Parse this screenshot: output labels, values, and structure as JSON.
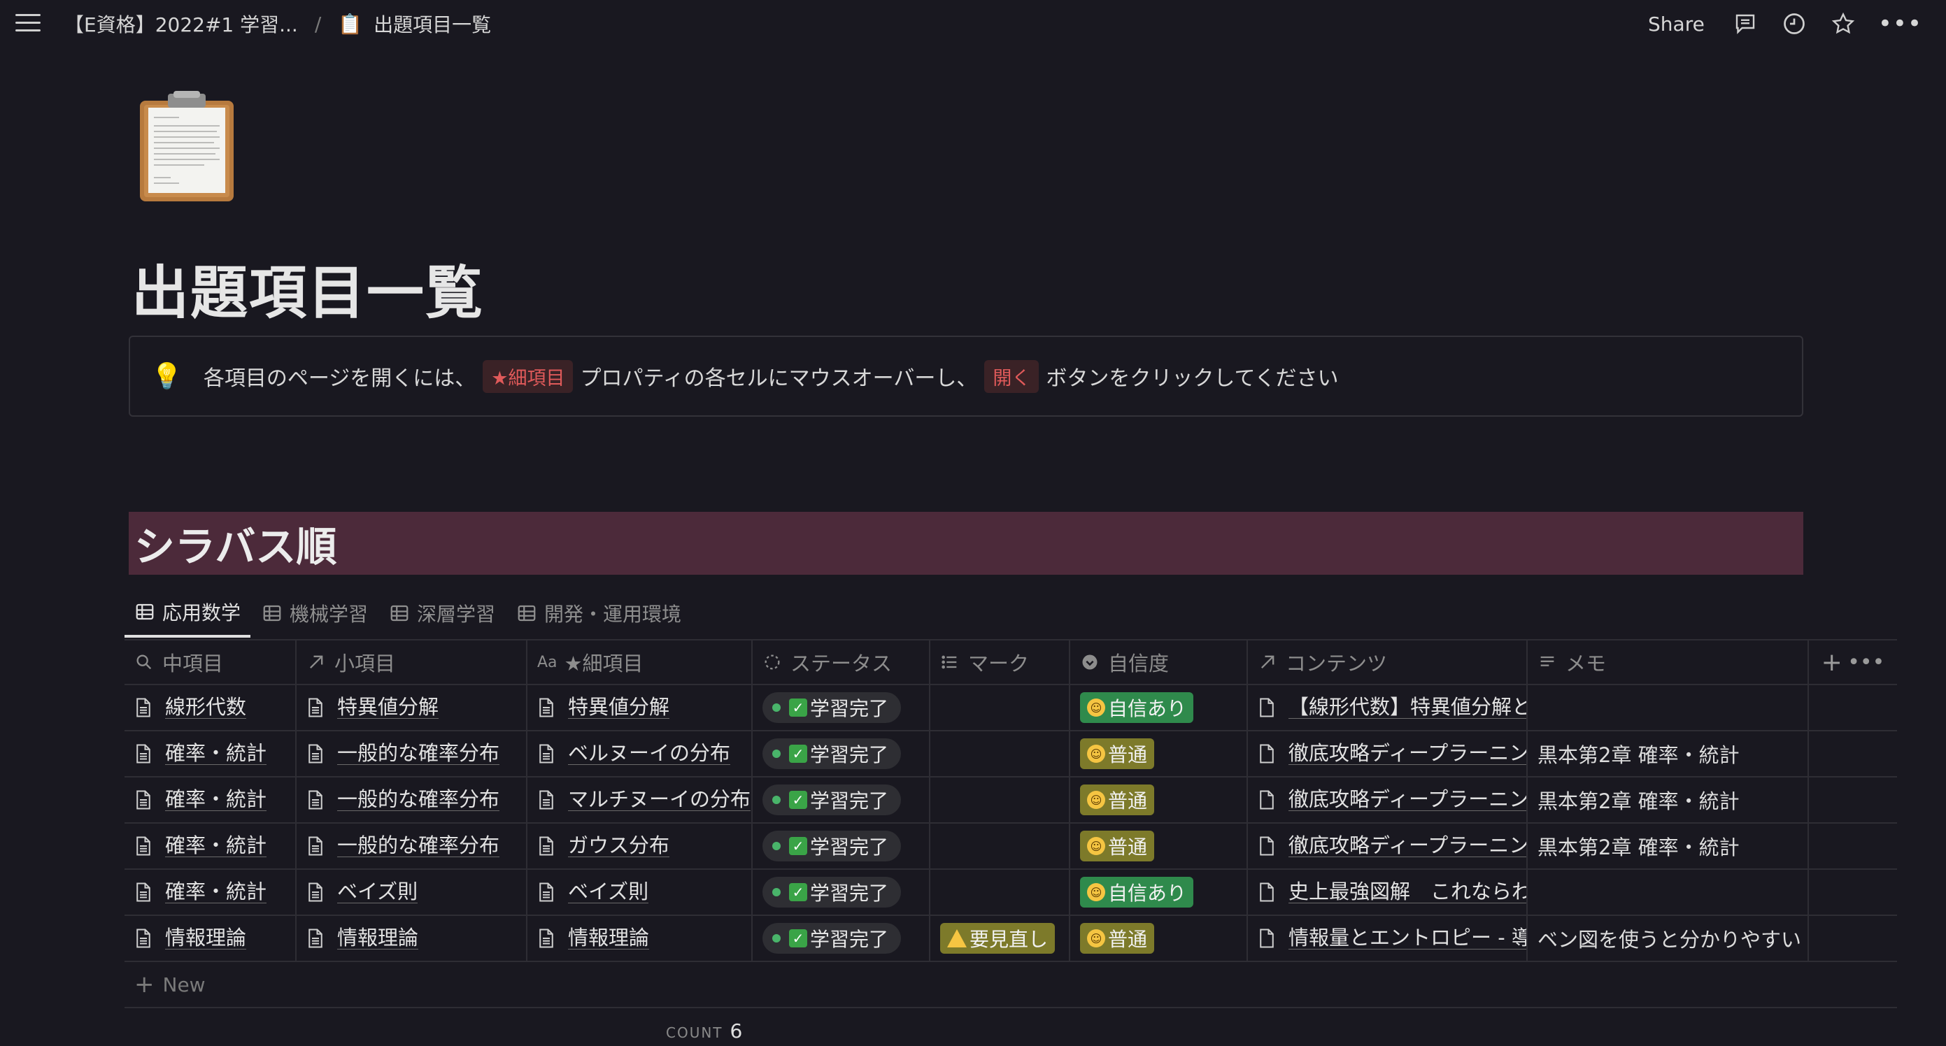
{
  "topbar": {
    "breadcrumb_parent": "【E資格】2022#1 学習...",
    "breadcrumb_sep": "/",
    "breadcrumb_current_icon": "📋",
    "breadcrumb_current": "出題項目一覧",
    "share_label": "Share",
    "icons": [
      "menu-icon",
      "comment-icon",
      "history-icon",
      "star-icon",
      "more-icon"
    ],
    "more_glyph": "•••"
  },
  "page": {
    "icon": "clipboard-icon",
    "title": "出題項目一覧"
  },
  "callout": {
    "icon": "💡",
    "text_1": "各項目のページを開くには、",
    "chip_1": "★細項目",
    "text_2": "プロパティの各セルにマウスオーバーし、",
    "chip_2": "開く",
    "text_3": "ボタンをクリックしてください"
  },
  "section": {
    "heading": "シラバス順"
  },
  "tabs": [
    {
      "label": "応用数学",
      "active": true
    },
    {
      "label": "機械学習",
      "active": false
    },
    {
      "label": "深層学習",
      "active": false
    },
    {
      "label": "開発・運用環境",
      "active": false
    }
  ],
  "table": {
    "columns": [
      "中項目",
      "小項目",
      "★細項目",
      "ステータス",
      "マーク",
      "自信度",
      "コンテンツ",
      "メモ"
    ],
    "add_column_glyph": "+",
    "more_glyph": "•••",
    "rows": [
      {
        "middle": "線形代数",
        "small": "特異値分解",
        "detail": "特異値分解",
        "status": "学習完了",
        "mark": "",
        "confidence": "自信あり",
        "confidence_type": "green",
        "content": "【線形代数】特異値分解と",
        "memo": ""
      },
      {
        "middle": "確率・統計",
        "small": "一般的な確率分布",
        "detail": "ベルヌーイの分布",
        "status": "学習完了",
        "mark": "",
        "confidence": "普通",
        "confidence_type": "olive",
        "content": "徹底攻略ディープラーニン",
        "memo": "黒本第2章 確率・統計"
      },
      {
        "middle": "確率・統計",
        "small": "一般的な確率分布",
        "detail": "マルチヌーイの分布",
        "status": "学習完了",
        "mark": "",
        "confidence": "普通",
        "confidence_type": "olive",
        "content": "徹底攻略ディープラーニン",
        "memo": "黒本第2章 確率・統計"
      },
      {
        "middle": "確率・統計",
        "small": "一般的な確率分布",
        "detail": "ガウス分布",
        "status": "学習完了",
        "mark": "",
        "confidence": "普通",
        "confidence_type": "olive",
        "content": "徹底攻略ディープラーニン",
        "memo": "黒本第2章 確率・統計"
      },
      {
        "middle": "確率・統計",
        "small": "ベイズ則",
        "detail": "ベイズ則",
        "status": "学習完了",
        "mark": "",
        "confidence": "自信あり",
        "confidence_type": "green",
        "content": "史上最強図解　これならわ",
        "memo": ""
      },
      {
        "middle": "情報理論",
        "small": "情報理論",
        "detail": "情報理論",
        "status": "学習完了",
        "mark": "要見直し",
        "confidence": "普通",
        "confidence_type": "olive",
        "content": "情報量とエントロピー - 導",
        "memo": "ベン図を使うと分かりやすい"
      }
    ],
    "new_label": "New",
    "count_label": "COUNT",
    "count_value": "6"
  },
  "colors": {
    "background": "#191820",
    "heading_band": "#4c2a3a",
    "chip_red": "#e05a5a",
    "status_green": "#49b46a",
    "tag_green": "#2f8a4c",
    "tag_olive": "#7d7a2a"
  }
}
